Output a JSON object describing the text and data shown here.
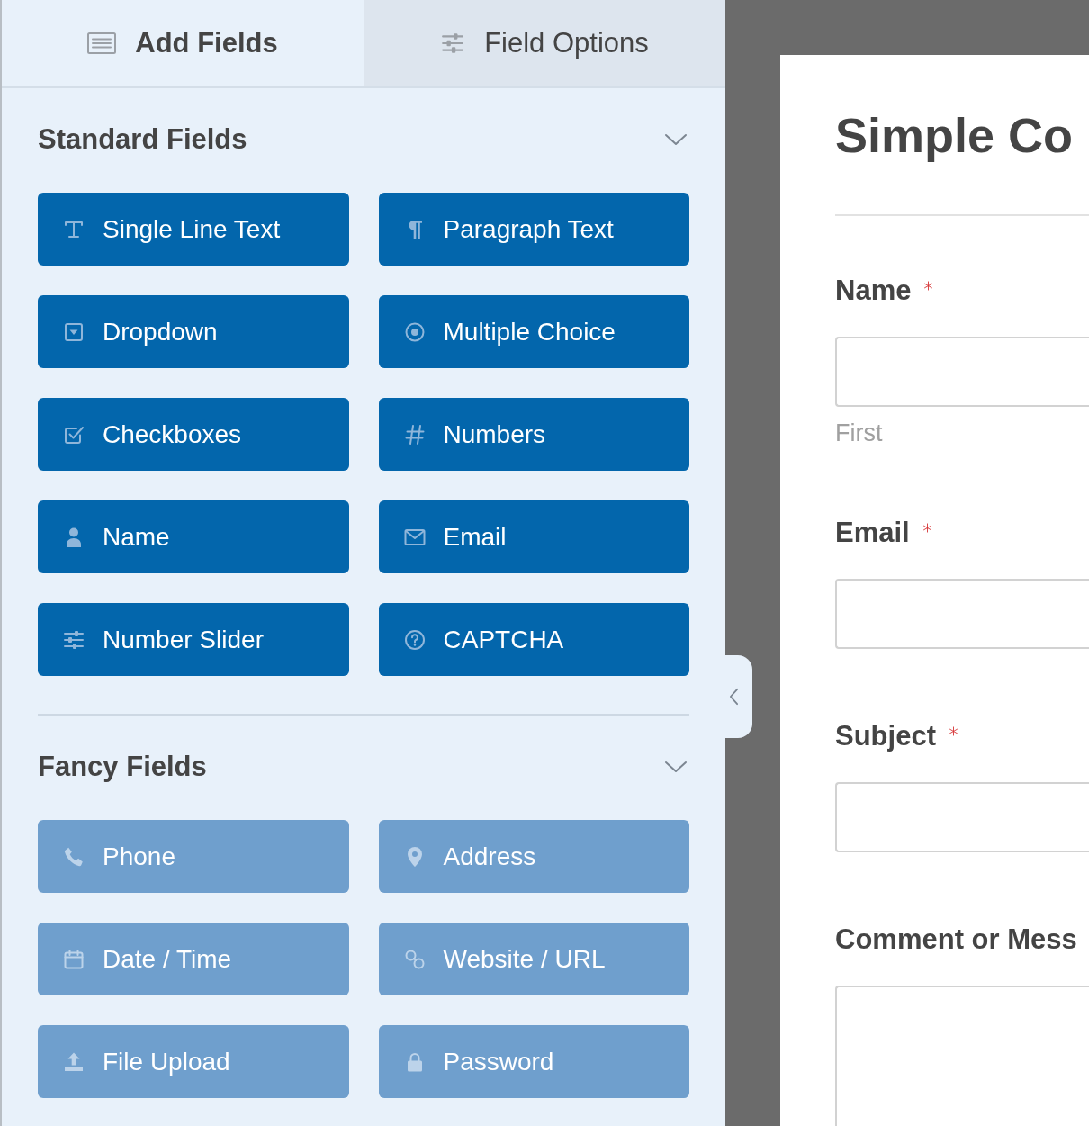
{
  "tabs": [
    {
      "label": "Add Fields",
      "selected": true
    },
    {
      "label": "Field Options",
      "selected": false
    }
  ],
  "sections": [
    {
      "title": "Standard Fields",
      "expanded": true,
      "fields": [
        {
          "label": "Single Line Text",
          "disabled": false
        },
        {
          "label": "Paragraph Text",
          "disabled": false
        },
        {
          "label": "Dropdown",
          "disabled": false
        },
        {
          "label": "Multiple Choice",
          "disabled": false
        },
        {
          "label": "Checkboxes",
          "disabled": false
        },
        {
          "label": "Numbers",
          "disabled": false
        },
        {
          "label": "Name",
          "disabled": false
        },
        {
          "label": "Email",
          "disabled": false
        },
        {
          "label": "Number Slider",
          "disabled": false
        },
        {
          "label": "CAPTCHA",
          "disabled": false
        }
      ]
    },
    {
      "title": "Fancy Fields",
      "expanded": true,
      "fields": [
        {
          "label": "Phone",
          "disabled": true
        },
        {
          "label": "Address",
          "disabled": true
        },
        {
          "label": "Date / Time",
          "disabled": true
        },
        {
          "label": "Website / URL",
          "disabled": true
        },
        {
          "label": "File Upload",
          "disabled": true
        },
        {
          "label": "Password",
          "disabled": true
        }
      ]
    }
  ],
  "form": {
    "title": "Simple Co",
    "fields": [
      {
        "kind": "input",
        "label": "Name",
        "required": true,
        "sublabel": "First"
      },
      {
        "kind": "input",
        "label": "Email",
        "required": true
      },
      {
        "kind": "input",
        "label": "Subject",
        "required": true
      },
      {
        "kind": "textarea",
        "label": "Comment or Mess"
      }
    ]
  }
}
